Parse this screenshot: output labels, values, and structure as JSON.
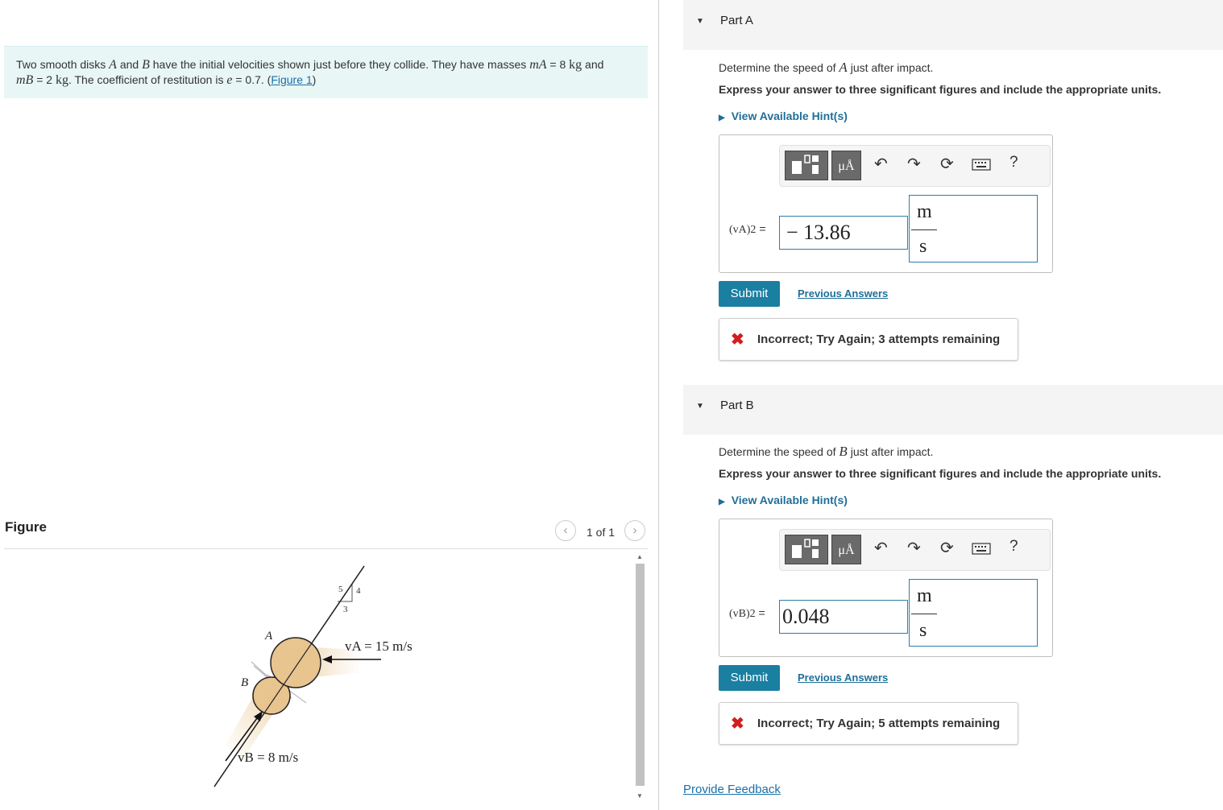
{
  "problem": {
    "t1": "Two smooth disks ",
    "a": "A",
    "t2": " and ",
    "b": "B",
    "t3": " have the initial velocities shown just before they collide. They have masses ",
    "mA": "mA",
    "t4": " = 8 ",
    "kg1": "kg",
    "t5": " and",
    "mB": "mB",
    "t6": " = 2 ",
    "kg2": "kg",
    "t7": ". The coefficient of restitution is ",
    "e": "e",
    "t8": " = 0.7. (",
    "link": "Figure 1",
    "t9": ")"
  },
  "figure": {
    "heading": "Figure",
    "pager": "1 of 1",
    "prev_icon": "chevron-left-icon",
    "next_icon": "chevron-right-icon",
    "label_A": "A",
    "label_B": "B",
    "label_vA": "vA = 15 m/s",
    "label_vB": "vB = 8 m/s",
    "slope_5": "5",
    "slope_4": "4",
    "slope_3": "3",
    "disk_color": "#e8c48f"
  },
  "parts": [
    {
      "title": "Part A",
      "q_pre": "Determine the speed of ",
      "q_var": "A",
      "q_post": " just after impact.",
      "instruction": "Express your answer to three significant figures and include the appropriate units.",
      "hint": "View Available Hint(s)",
      "var_label": "(vA)2",
      "eq": " =",
      "value": "− 13.86",
      "unit_num": "m",
      "unit_den": "s",
      "submit": "Submit",
      "previous": "Previous Answers",
      "feedback": "Incorrect; Try Again; 3 attempts remaining"
    },
    {
      "title": "Part B",
      "q_pre": "Determine the speed of ",
      "q_var": "B",
      "q_post": " just after impact.",
      "instruction": "Express your answer to three significant figures and include the appropriate units.",
      "hint": "View Available Hint(s)",
      "var_label": "(vB)2",
      "eq": " =",
      "value": "0.048",
      "unit_num": "m",
      "unit_den": "s",
      "submit": "Submit",
      "previous": "Previous Answers",
      "feedback": "Incorrect; Try Again; 5 attempts remaining"
    }
  ],
  "toolbar": {
    "units_label": "μÅ",
    "help": "?",
    "icons": [
      "templates-icon",
      "units-icon",
      "undo-icon",
      "redo-icon",
      "reset-icon",
      "keyboard-icon",
      "help-icon"
    ]
  },
  "provide_feedback": "Provide Feedback",
  "colors": {
    "accent": "#1a7fa0",
    "link": "#1a6fa8",
    "error": "#d21e1e",
    "problem_bg": "#e8f6f6"
  }
}
